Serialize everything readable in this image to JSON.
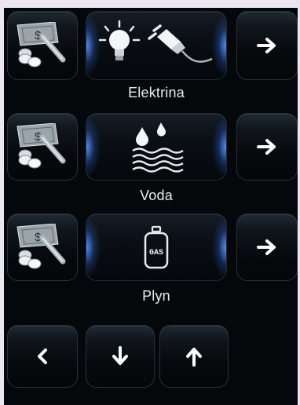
{
  "rows": [
    {
      "label": "Elektrina",
      "pay_icon": "bill-coins-pen-icon",
      "main_icons": [
        "light-bulb-icon",
        "electric-plug-icon"
      ],
      "next_icon": "arrow-right-icon"
    },
    {
      "label": "Voda",
      "pay_icon": "bill-coins-pen-icon",
      "main_icons": [
        "water-drops-waves-icon"
      ],
      "next_icon": "arrow-right-icon"
    },
    {
      "label": "Plyn",
      "pay_icon": "bill-coins-pen-icon",
      "main_icons": [
        "gas-cylinder-icon"
      ],
      "next_icon": "arrow-right-icon"
    }
  ],
  "bill_symbol": "$",
  "gas_text": "GAS",
  "nav": [
    {
      "name": "back",
      "icon": "chevron-left-icon"
    },
    {
      "name": "down",
      "icon": "arrow-down-icon"
    },
    {
      "name": "up",
      "icon": "arrow-up-icon"
    }
  ],
  "colors": {
    "panel": "#05080b",
    "glow": "#5a96ff",
    "text": "#e8ecef",
    "bill": "#9aa4aa"
  }
}
